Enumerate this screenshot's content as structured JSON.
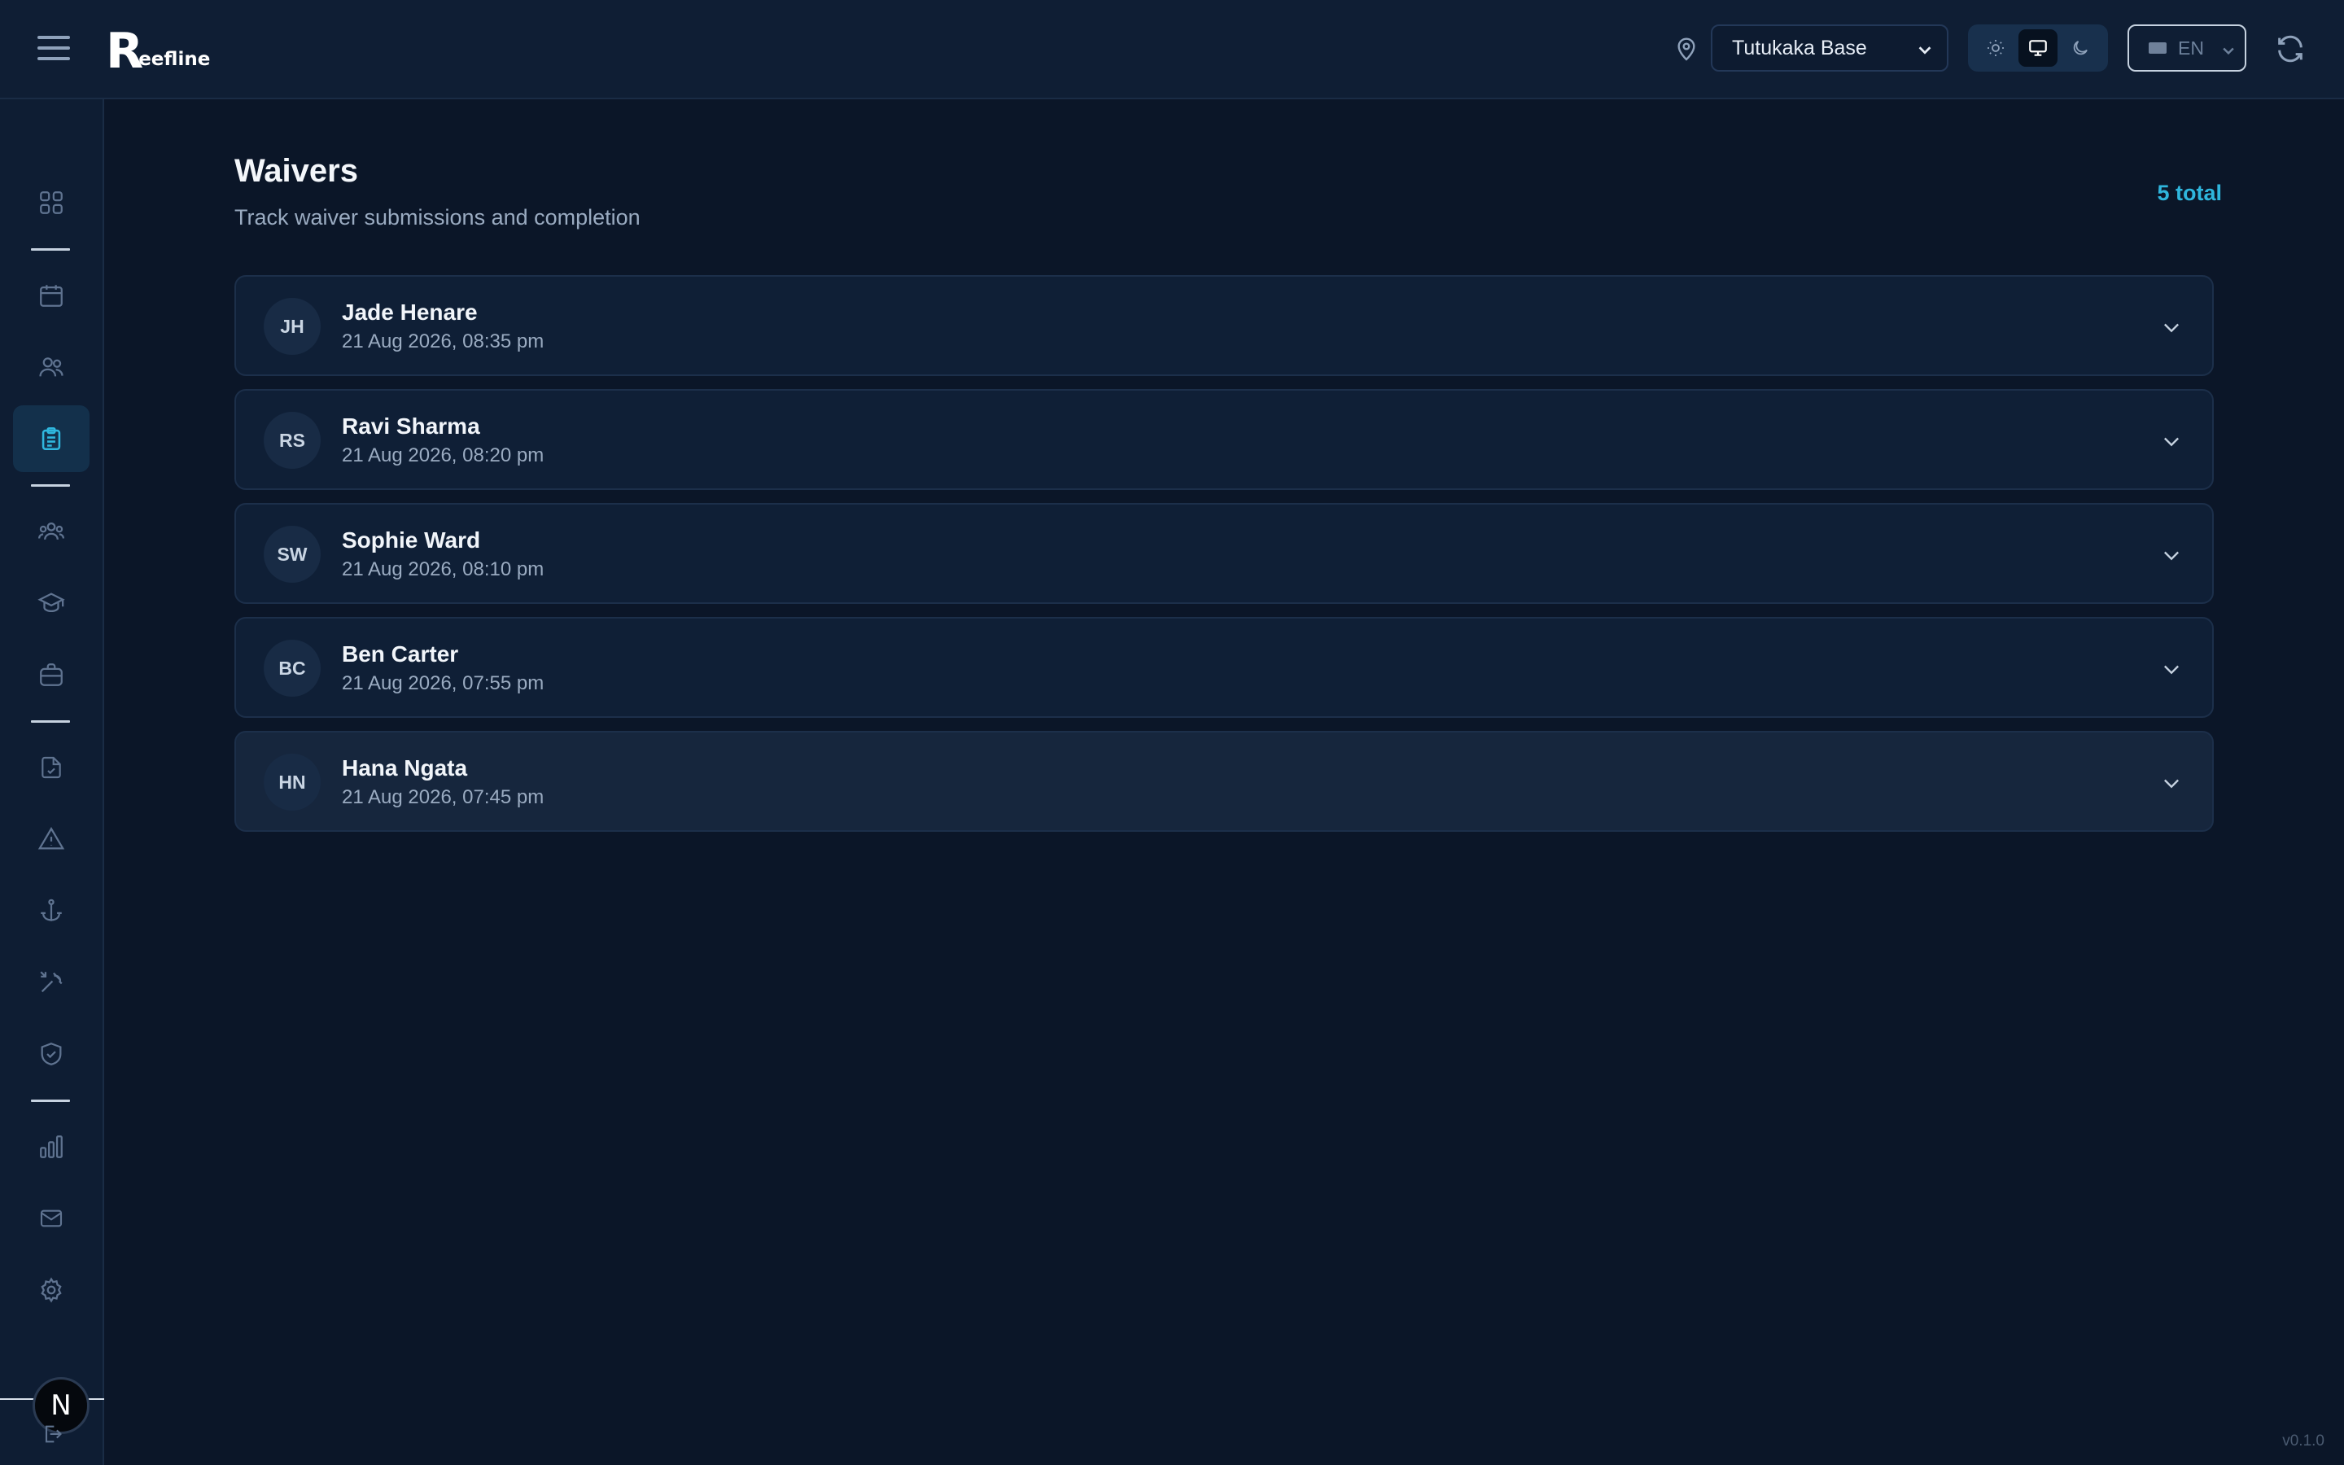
{
  "header": {
    "logo_initial": "R",
    "logo_text": "eefline",
    "location": "Tutukaka Base",
    "language": "EN"
  },
  "page": {
    "title": "Waivers",
    "subtitle": "Track waiver submissions and completion",
    "total": "5 total"
  },
  "waivers": [
    {
      "initials": "JH",
      "name": "Jade Henare",
      "date": "21 Aug 2026, 08:35 pm"
    },
    {
      "initials": "RS",
      "name": "Ravi Sharma",
      "date": "21 Aug 2026, 08:20 pm"
    },
    {
      "initials": "SW",
      "name": "Sophie Ward",
      "date": "21 Aug 2026, 08:10 pm"
    },
    {
      "initials": "BC",
      "name": "Ben Carter",
      "date": "21 Aug 2026, 07:55 pm"
    },
    {
      "initials": "HN",
      "name": "Hana Ngata",
      "date": "21 Aug 2026, 07:45 pm"
    }
  ],
  "user": {
    "initial": "N"
  },
  "version": "v0.1.0",
  "colors": {
    "accent": "#2fb6dd",
    "background": "#0b1628",
    "surface": "#0f1f36"
  }
}
